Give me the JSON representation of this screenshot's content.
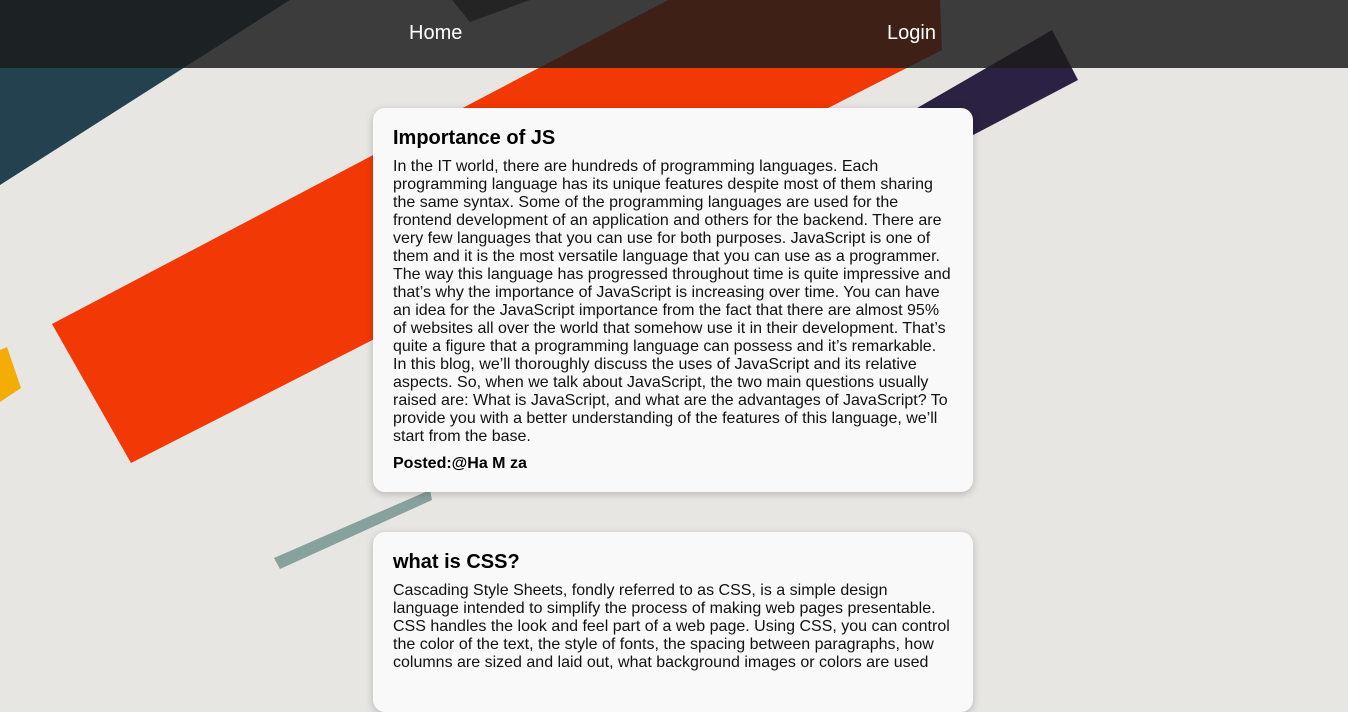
{
  "nav": {
    "home_label": "Home",
    "login_label": "Login"
  },
  "posts": [
    {
      "title": "Importance of JS",
      "body": "In the IT world, there are hundreds of programming languages. Each programming language has its unique features despite most of them sharing the same syntax. Some of the programming languages are used for the frontend development of an application and others for the backend. There are very few languages that you can use for both purposes. JavaScript is one of them and it is the most versatile language that you can use as a programmer. The way this language has progressed throughout time is quite impressive and that’s why the importance of JavaScript is increasing over time. You can have an idea for the JavaScript importance from the fact that there are almost 95% of websites all over the world that somehow use it in their development. That’s quite a figure that a programming language can possess and it’s remarkable. In this blog, we’ll thoroughly discuss the uses of JavaScript and its relative aspects. So, when we talk about JavaScript, the two main questions usually raised are: What is JavaScript, and what are the advantages of JavaScript? To provide you with a better understanding of the features of this language, we’ll start from the base.",
      "author": "Posted:@Ha M za"
    },
    {
      "title": "what is CSS?",
      "body": "Cascading Style Sheets, fondly referred to as CSS, is a simple design language intended to simplify the process of making web pages presentable. CSS handles the look and feel part of a web page. Using CSS, you can control the color of the text, the style of fonts, the spacing between paragraphs, how columns are sized and laid out, what background images or colors are used"
    }
  ],
  "colors": {
    "page_background": "#e8e6e3",
    "navbar_background": "#1b1b1b",
    "accent_red": "#f23805",
    "accent_navy": "#2b2142",
    "accent_slate": "#24414f",
    "accent_yellow": "#f4ad06",
    "accent_sage": "#87a19d",
    "card_background": "#f9f9f9"
  }
}
